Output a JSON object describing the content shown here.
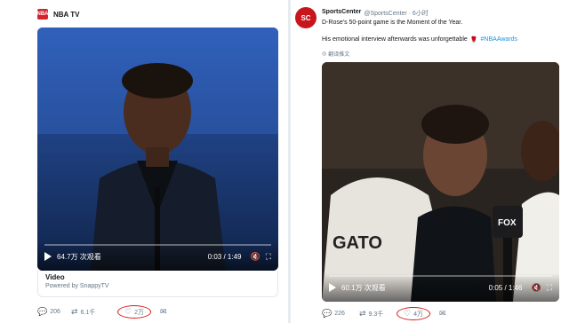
{
  "left": {
    "account": {
      "name": "NBA TV",
      "avatar_text": "NBA"
    },
    "video": {
      "views": "64.7万 次观看",
      "time": "0:03 / 1:49",
      "progress": 0.03
    },
    "card": {
      "title": "Video",
      "subtitle": "Powered by SnappyTV"
    },
    "actions": {
      "replies": "206",
      "retweets": "6.1千",
      "likes": "2万"
    }
  },
  "right": {
    "account": {
      "name": "SportsCenter",
      "handle": "@SportsCenter · 6小时",
      "avatar_text": "SC"
    },
    "tweet": {
      "line1": "D-Rose's 50-point game is the Moment of the Year.",
      "line2": "His emotional interview afterwards was unforgettable",
      "hashtag": "#NBAAwards",
      "translate": "翻译推文"
    },
    "video": {
      "views": "60.1万 次观看",
      "time": "0:05 / 1:46",
      "progress": 0.05
    },
    "actions": {
      "replies": "226",
      "retweets": "9.3千",
      "likes": "4万"
    }
  },
  "colors": {
    "accent": "#1b95e0",
    "circle": "#d51a1a",
    "muted": "#657786"
  }
}
